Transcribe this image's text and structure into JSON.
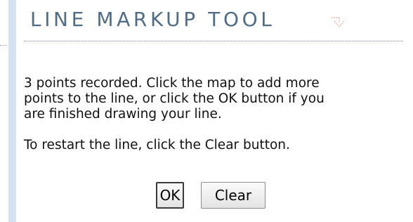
{
  "panel": {
    "title": "LINE MARKUP TOOL",
    "collapse_icon": "chevron-down-icon"
  },
  "message": {
    "line1": "3 points recorded. Click the map to add more",
    "line2": "points to the line, or click the OK button if you",
    "line3": "are finished drawing your line.",
    "restart_text": "To restart the line, click the Clear button."
  },
  "buttons": {
    "ok_label": "OK",
    "clear_label": "Clear"
  },
  "colors": {
    "title": "#4f6d88",
    "separator": "#d5e2f0",
    "icon": "#e59a8a"
  }
}
